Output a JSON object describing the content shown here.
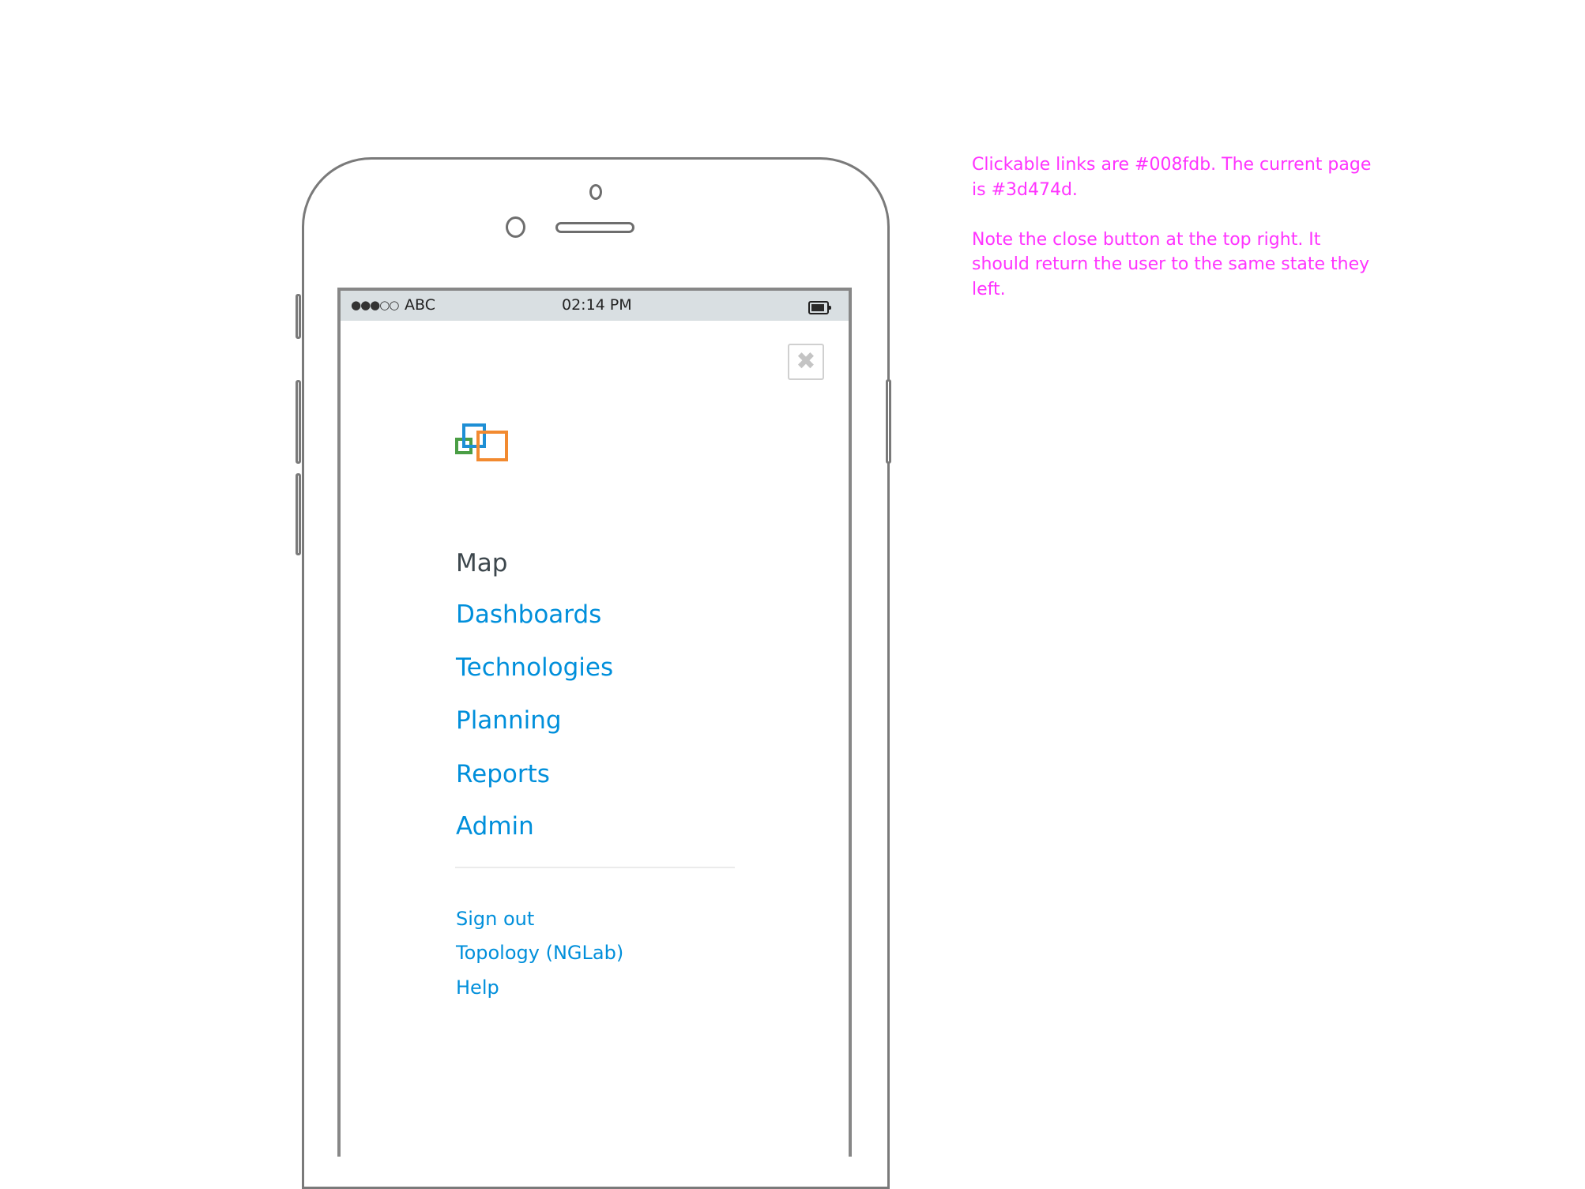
{
  "status_bar": {
    "signal": "●●●○○",
    "carrier": "ABC",
    "time": "02:14 PM",
    "battery_icon": "battery-icon"
  },
  "close_button": {
    "glyph": "✖",
    "icon": "close-icon"
  },
  "logo": {
    "colors": {
      "green": "#4a9e45",
      "blue": "#1e8fd5",
      "orange": "#f28a30"
    }
  },
  "menu": {
    "current": "Map",
    "items": [
      {
        "label": "Map",
        "current": true
      },
      {
        "label": "Dashboards",
        "current": false
      },
      {
        "label": "Technologies",
        "current": false
      },
      {
        "label": "Planning",
        "current": false
      },
      {
        "label": "Reports",
        "current": false
      },
      {
        "label": "Admin",
        "current": false
      }
    ],
    "secondary": [
      {
        "label": "Sign out"
      },
      {
        "label": "Topology (NGLab)"
      },
      {
        "label": "Help"
      }
    ]
  },
  "colors": {
    "link": "#008fdb",
    "current_page": "#3d474d",
    "annotation": "#ff33ff"
  },
  "annotation": {
    "paragraphs": [
      "Clickable links are #008fdb. The current page is #3d474d.",
      "Note the close button at the top right. It should return the user to the same state they left."
    ]
  }
}
